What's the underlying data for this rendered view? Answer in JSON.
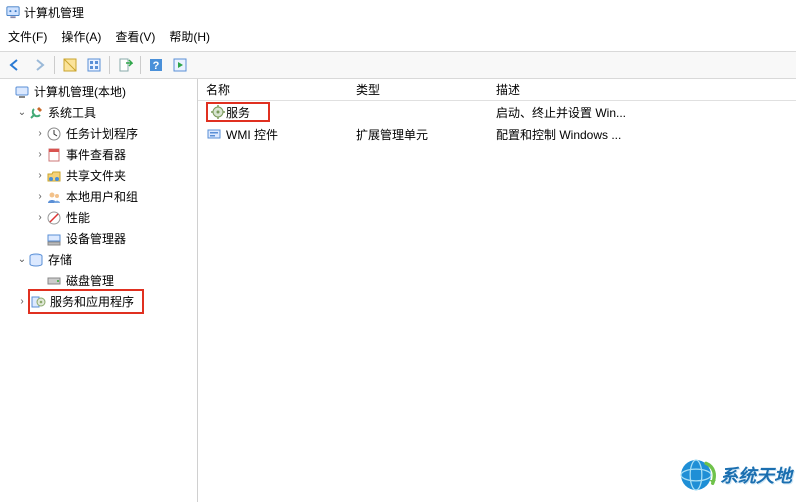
{
  "titlebar": {
    "title": "计算机管理"
  },
  "menu": {
    "file": "文件(F)",
    "action": "操作(A)",
    "view": "查看(V)",
    "help": "帮助(H)"
  },
  "tree": {
    "root": "计算机管理(本地)",
    "systools": "系统工具",
    "scheduler": "任务计划程序",
    "eventviewer": "事件查看器",
    "sharedfolders": "共享文件夹",
    "localusers": "本地用户和组",
    "performance": "性能",
    "devmgr": "设备管理器",
    "storage": "存储",
    "diskmgmt": "磁盘管理",
    "servicesapps": "服务和应用程序"
  },
  "list": {
    "headers": {
      "name": "名称",
      "type": "类型",
      "desc": "描述"
    },
    "rows": [
      {
        "name": "服务",
        "type": "",
        "desc": "启动、终止并设置 Win..."
      },
      {
        "name": "WMI 控件",
        "type": "扩展管理单元",
        "desc": "配置和控制 Windows ..."
      }
    ]
  },
  "watermark": {
    "text": "系统天地"
  }
}
